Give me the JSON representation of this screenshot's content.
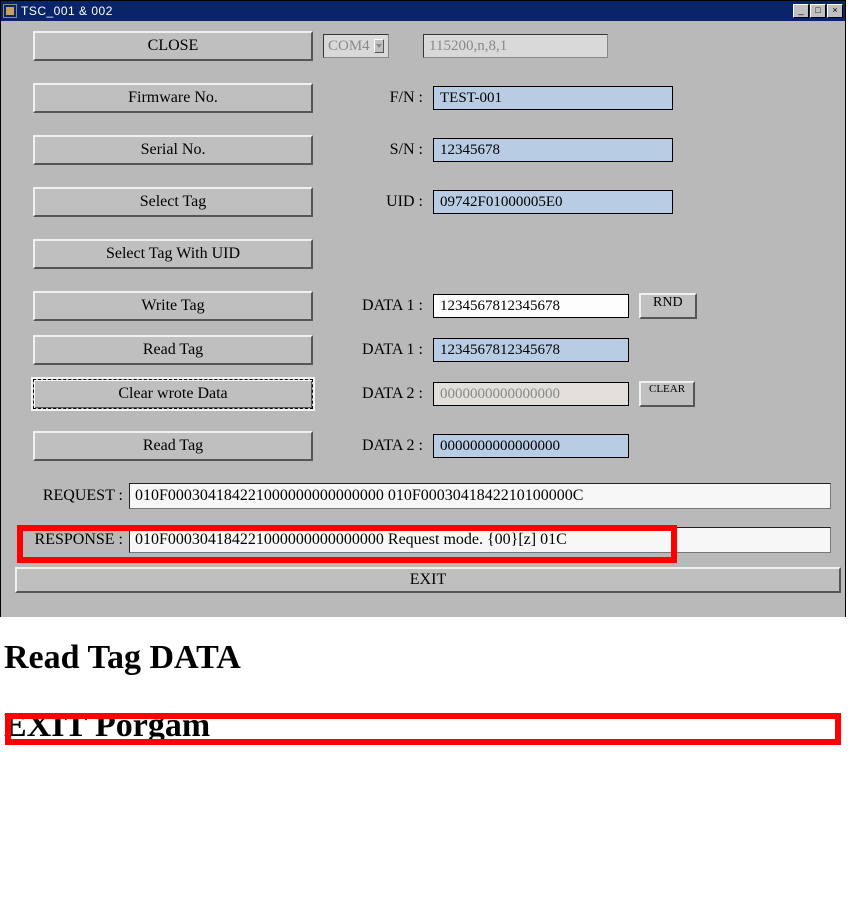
{
  "window": {
    "title": "TSC_001 & 002",
    "min": "_",
    "restore": "□",
    "close": "×"
  },
  "buttons": {
    "close": "CLOSE",
    "firmware": "Firmware No.",
    "serial": "Serial No.",
    "select_tag": "Select Tag",
    "select_tag_uid": "Select Tag With UID",
    "write_tag": "Write Tag",
    "read_tag1": "Read Tag",
    "clear_wrote": "Clear wrote Data",
    "read_tag2": "Read Tag",
    "rnd": "RND",
    "clear": "CLEAR",
    "exit": "EXIT"
  },
  "port": {
    "sel": "COM4",
    "config": "115200,n,8,1"
  },
  "labels": {
    "fn": "F/N :",
    "sn": "S/N :",
    "uid": "UID :",
    "data1a": "DATA 1 :",
    "data1b": "DATA 1 :",
    "data2a": "DATA 2 :",
    "data2b": "DATA 2 :",
    "request": "REQUEST :",
    "response": "RESPONSE :"
  },
  "values": {
    "fn": "TEST-001",
    "sn": "12345678",
    "uid": "09742F01000005E0",
    "data1_write": "1234567812345678",
    "data1_read": "1234567812345678",
    "data2_write": "0000000000000000",
    "data2_read": "0000000000000000",
    "request": "010F000304184221000000000000000   010F0003041842210100000C",
    "response": "010F000304184221000000000000000  Request mode.  {00}[z]    01C"
  },
  "captions": {
    "line1": "Read Tag DATA",
    "line2": "EXIT Porgam"
  }
}
